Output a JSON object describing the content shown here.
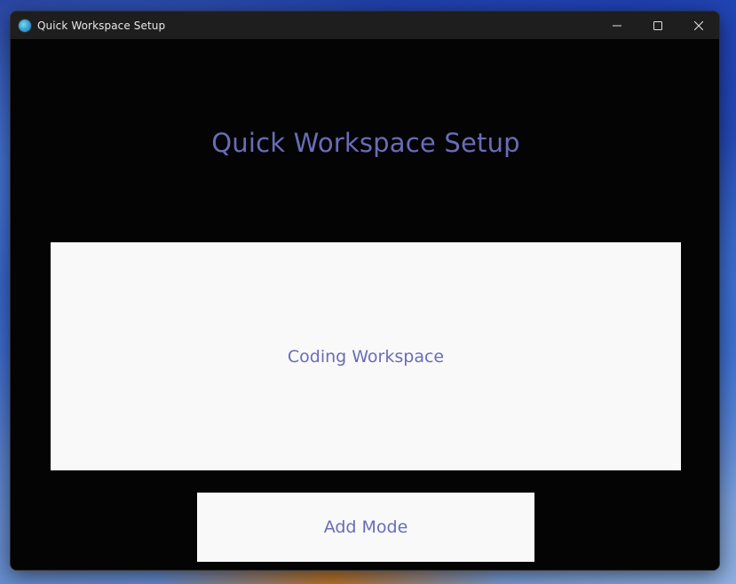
{
  "window": {
    "title": "Quick Workspace Setup",
    "icon": "app-icon"
  },
  "main": {
    "heading": "Quick Workspace Setup",
    "modes": [
      {
        "label": "Coding Workspace"
      }
    ],
    "add_button_label": "Add Mode"
  },
  "colors": {
    "accent_text": "#6a6cb8",
    "window_background": "#040404",
    "card_background": "#f9f9f9",
    "titlebar_background": "#1e1e1e"
  }
}
